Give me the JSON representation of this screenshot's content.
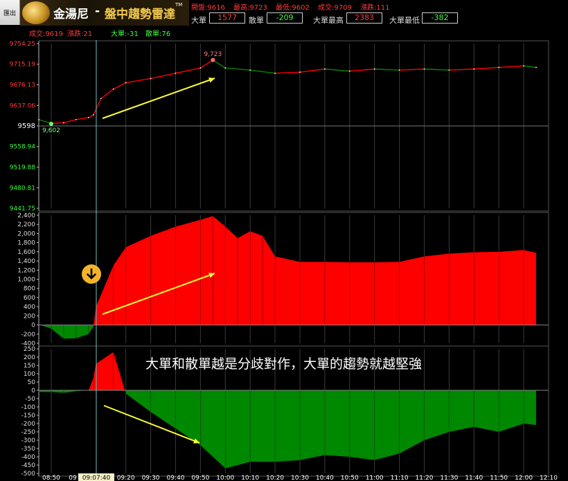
{
  "toolbar": {
    "export_label": "匯出"
  },
  "brand": {
    "name": "金湯尼",
    "dash": "-",
    "title": "盤中趨勢雷達",
    "tm": "TM"
  },
  "stats": {
    "open": "開盤:9616",
    "high": "最高:9723",
    "low": "最低:9602",
    "deal": "成交:9709",
    "change": "漲跌:111"
  },
  "orders": {
    "big_label": "大單",
    "big_value": "1577",
    "retail_label": "散單",
    "retail_value": "-209",
    "big_high_label": "大單最高",
    "big_high_value": "2383",
    "big_low_label": "大單最低",
    "big_low_value": "-382"
  },
  "cursor_info": {
    "deal": "成交:9619",
    "change": "漲跌:21",
    "big": "大單:-31",
    "retail": "散單:76"
  },
  "cursor_time": "09:07:40",
  "caption": "大單和散單越是分歧對作，大單的趨勢就越堅強",
  "colors": {
    "up": "#ff0000",
    "down": "#008800",
    "arrow": "#ffff33",
    "accent": "#f2c94c"
  },
  "icons": {
    "down_badge": "arrow-down-circle-icon"
  },
  "chart_data": [
    {
      "type": "line",
      "title": "",
      "xlabel": "",
      "ylabel": "",
      "ylim": [
        9441.75,
        9754.25
      ],
      "y_ticks": [
        "9754.25",
        "9715.19",
        "9676.13",
        "9637.06",
        "9598",
        "9558.94",
        "9519.88",
        "9480.81",
        "9441.75"
      ],
      "reference": 9598,
      "x": [
        "08:45",
        "08:50",
        "08:55",
        "09:00",
        "09:05",
        "09:07",
        "09:10",
        "09:15",
        "09:20",
        "09:30",
        "09:40",
        "09:50",
        "09:55",
        "10:00",
        "10:10",
        "10:20",
        "10:30",
        "10:40",
        "10:50",
        "11:00",
        "11:10",
        "11:20",
        "11:30",
        "11:40",
        "11:50",
        "12:00",
        "12:05"
      ],
      "values": [
        9610,
        9603,
        9604,
        9610,
        9614,
        9619,
        9650,
        9668,
        9680,
        9688,
        9698,
        9708,
        9723,
        9708,
        9704,
        9698,
        9700,
        9706,
        9702,
        9706,
        9704,
        9706,
        9704,
        9706,
        9709,
        9712,
        9709
      ],
      "annotations": [
        {
          "label": "9,723",
          "x": "09:55",
          "y": 9723,
          "color": "up"
        },
        {
          "label": "9,602",
          "x": "08:50",
          "y": 9602,
          "color": "down"
        }
      ]
    },
    {
      "type": "area",
      "title": "",
      "xlabel": "",
      "ylabel": "",
      "ylim": [
        -400,
        2400
      ],
      "y_ticks": [
        "2,400",
        "2,200",
        "2,000",
        "1,800",
        "1,600",
        "1,400",
        "1,200",
        "1,000",
        "800",
        "600",
        "400",
        "200",
        "0",
        "-200",
        "-400"
      ],
      "x": [
        "08:45",
        "08:50",
        "08:55",
        "09:00",
        "09:05",
        "09:07",
        "09:08",
        "09:15",
        "09:20",
        "09:30",
        "09:40",
        "09:50",
        "09:55",
        "10:00",
        "10:05",
        "10:10",
        "10:15",
        "10:20",
        "10:30",
        "10:40",
        "10:50",
        "11:00",
        "11:10",
        "11:20",
        "11:30",
        "11:40",
        "11:50",
        "12:00",
        "12:05"
      ],
      "values": [
        10,
        -80,
        -300,
        -290,
        -200,
        -31,
        400,
        1300,
        1700,
        1950,
        2150,
        2300,
        2383,
        2150,
        1900,
        2050,
        1950,
        1500,
        1380,
        1380,
        1370,
        1370,
        1380,
        1500,
        1560,
        1590,
        1600,
        1640,
        1577
      ]
    },
    {
      "type": "area",
      "title": "",
      "xlabel": "",
      "ylabel": "",
      "ylim": [
        -500,
        250
      ],
      "y_ticks": [
        "250",
        "200",
        "150",
        "100",
        "50",
        "0",
        "-50",
        "-100",
        "-150",
        "-200",
        "-250",
        "-300",
        "-350",
        "-400",
        "-450",
        "-500"
      ],
      "x": [
        "08:45",
        "08:50",
        "08:55",
        "09:00",
        "09:05",
        "09:07",
        "09:08",
        "09:15",
        "09:20",
        "09:30",
        "09:40",
        "09:50",
        "10:00",
        "10:10",
        "10:20",
        "10:30",
        "10:40",
        "10:50",
        "11:00",
        "11:10",
        "11:20",
        "11:30",
        "11:40",
        "11:50",
        "12:00",
        "12:05"
      ],
      "values": [
        -10,
        -10,
        -15,
        -5,
        0,
        76,
        160,
        230,
        -20,
        -130,
        -230,
        -330,
        -470,
        -430,
        -430,
        -420,
        -390,
        -400,
        -420,
        -380,
        -300,
        -250,
        -220,
        -250,
        -200,
        -209
      ]
    }
  ],
  "x_axis": {
    "labels": [
      "08:50",
      "09",
      "09:07:40",
      "09:20",
      "09:30",
      "09:40",
      "09:50",
      "10:00",
      "10:10",
      "10:20",
      "10:30",
      "10:40",
      "10:50",
      "11:00",
      "11:10",
      "11:20",
      "11:30",
      "11:40",
      "11:50",
      "12:00",
      "12:10"
    ]
  }
}
